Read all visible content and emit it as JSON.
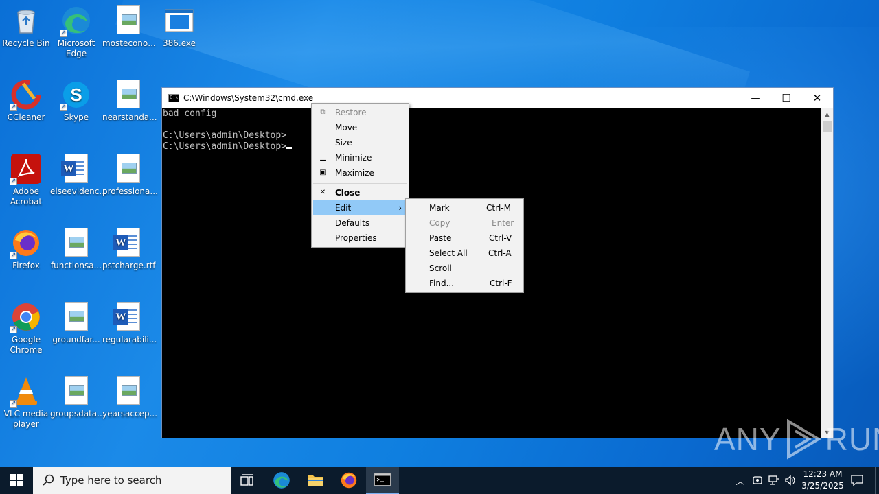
{
  "desktop": {
    "icons": [
      {
        "label": "Recycle Bin",
        "icon": "recycle-bin-icon"
      },
      {
        "label": "Microsoft Edge",
        "icon": "edge-icon"
      },
      {
        "label": "mosteconо...",
        "icon": "image-file-icon"
      },
      {
        "label": "386.exe",
        "icon": "exe-icon"
      },
      {
        "label": "CCleaner",
        "icon": "ccleaner-icon"
      },
      {
        "label": "Skype",
        "icon": "skype-icon"
      },
      {
        "label": "nearstanda...",
        "icon": "image-file-icon"
      },
      {
        "label": "Adobe Acrobat",
        "icon": "acrobat-icon"
      },
      {
        "label": "elseevidenc...",
        "icon": "word-doc-icon"
      },
      {
        "label": "professiona...",
        "icon": "image-file-icon"
      },
      {
        "label": "Firefox",
        "icon": "firefox-icon"
      },
      {
        "label": "functionsa...",
        "icon": "image-file-icon"
      },
      {
        "label": "pstcharge.rtf",
        "icon": "word-doc-icon"
      },
      {
        "label": "Google Chrome",
        "icon": "chrome-icon"
      },
      {
        "label": "groundfar...",
        "icon": "image-file-icon"
      },
      {
        "label": "regularabili...",
        "icon": "word-doc-icon"
      },
      {
        "label": "VLC media player",
        "icon": "vlc-icon"
      },
      {
        "label": "groupsdata...",
        "icon": "image-file-icon"
      },
      {
        "label": "yearsaccep...",
        "icon": "image-file-icon"
      }
    ]
  },
  "cmd": {
    "title": "C:\\Windows\\System32\\cmd.exe",
    "minimize": "—",
    "maximize": "☐",
    "close": "✕",
    "lines": [
      "bad config",
      "",
      "C:\\Users\\admin\\Desktop>",
      "C:\\Users\\admin\\Desktop>"
    ]
  },
  "system_menu": {
    "restore": "Restore",
    "move": "Move",
    "size": "Size",
    "minimize": "Minimize",
    "maximize": "Maximize",
    "close": "Close",
    "edit": "Edit",
    "defaults": "Defaults",
    "properties": "Properties"
  },
  "edit_menu": {
    "mark": "Mark",
    "mark_sc": "Ctrl-M",
    "copy": "Copy",
    "copy_sc": "Enter",
    "paste": "Paste",
    "paste_sc": "Ctrl-V",
    "select_all": "Select All",
    "select_all_sc": "Ctrl-A",
    "scroll": "Scroll",
    "find": "Find...",
    "find_sc": "Ctrl-F"
  },
  "watermark": {
    "left": "ANY",
    "right": "RUN"
  },
  "taskbar": {
    "search_placeholder": "Type here to search",
    "time": "12:23 AM",
    "date": "3/25/2025"
  }
}
